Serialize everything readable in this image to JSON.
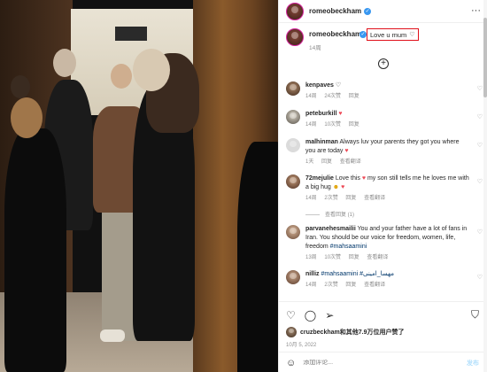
{
  "post": {
    "username": "romeobeckham",
    "caption": "Love u mum",
    "caption_time": "14周"
  },
  "comments": [
    {
      "username": "kenpaves",
      "emoji": "♡",
      "time": "14周",
      "likes": "24次赞",
      "reply": "回复"
    },
    {
      "username": "peteburkill",
      "emoji": "♥",
      "time": "14周",
      "likes": "10次赞",
      "reply": "回复"
    },
    {
      "username": "malhinman",
      "text": "Always luv your parents they got you where you are today",
      "emoji": "♥",
      "time": "1天",
      "reply": "回复",
      "translate": "查看翻译"
    },
    {
      "username": "72mejulie",
      "text": "Love this",
      "text2": "my son still tells me he loves me with a big hug",
      "time": "14周",
      "likes": "2次赞",
      "reply": "回复",
      "translate": "查看翻译",
      "view_replies": "查看回复 (1)"
    },
    {
      "username": "parvanehesmailii",
      "text": "You and your father have a lot of fans in Iran. You should be our voice for freedom, women, life, freedom",
      "hashtag": "#mahsaamini",
      "time": "13周",
      "likes": "10次赞",
      "reply": "回复",
      "translate": "查看翻译"
    },
    {
      "username": "nilliz",
      "hashtags": "#mahsaamini #مهسا_امینی",
      "time": "14周",
      "likes": "2次赞",
      "reply": "回复",
      "translate": "查看翻译"
    }
  ],
  "footer": {
    "liked_by": "cruzbeckham和其他7.9万位用户赞了",
    "date": "10月 5, 2022",
    "comment_placeholder": "添加评论...",
    "post_label": "发布"
  },
  "icons": {
    "heart": "heart-icon",
    "comment": "comment-icon",
    "share": "share-icon",
    "bookmark": "bookmark-icon",
    "emoji": "emoji-icon",
    "more": "more-icon",
    "plus": "plus-circle-icon"
  },
  "colors": {
    "verified": "#3897f0",
    "heart_red": "#ed4956",
    "highlight_box": "#e0101a"
  }
}
